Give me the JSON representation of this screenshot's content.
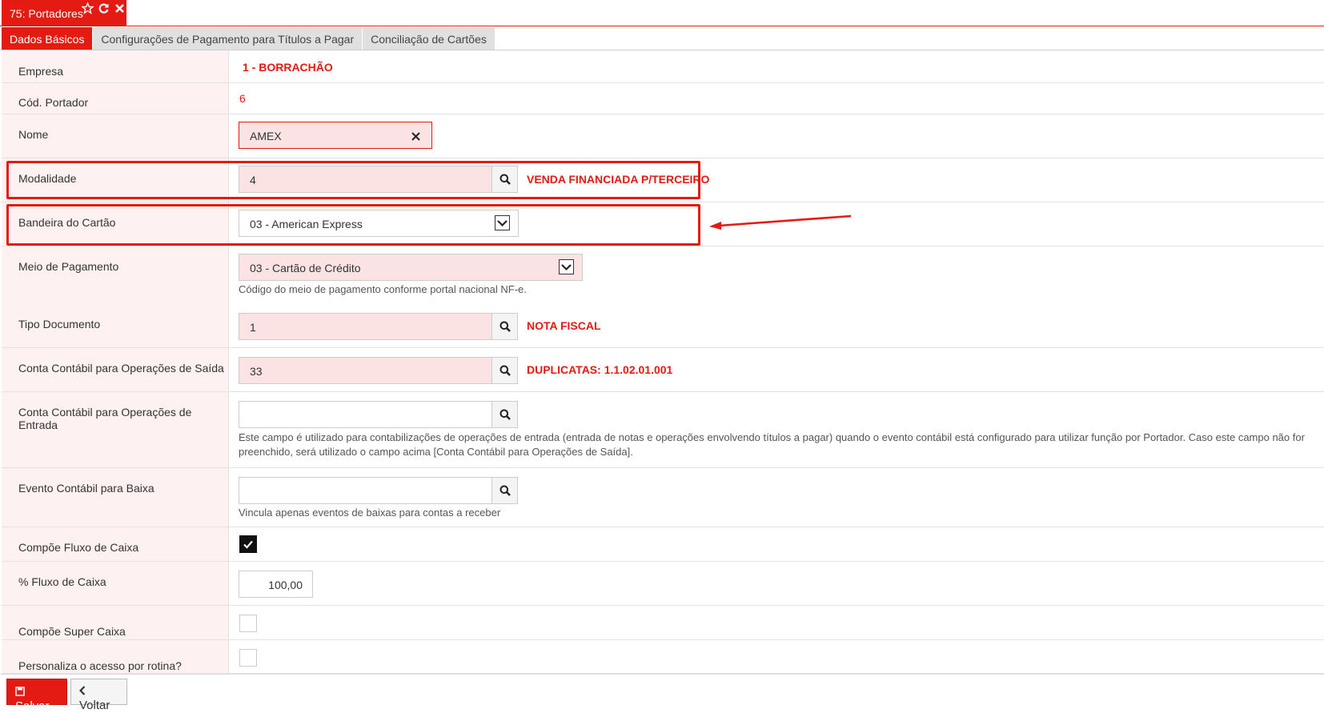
{
  "window": {
    "title": "75: Portadores"
  },
  "tabs": [
    {
      "label": "Dados Básicos"
    },
    {
      "label": "Configurações de Pagamento para Títulos a Pagar"
    },
    {
      "label": "Conciliação de Cartões"
    }
  ],
  "form": {
    "empresa": {
      "label": "Empresa",
      "value": "1 - BORRACHÃO"
    },
    "cod_portador": {
      "label": "Cód. Portador",
      "value": "6"
    },
    "nome": {
      "label": "Nome",
      "value": "AMEX"
    },
    "modalidade": {
      "label": "Modalidade",
      "value": "4",
      "description": "VENDA FINANCIADA P/TERCEIRO"
    },
    "bandeira": {
      "label": "Bandeira do Cartão",
      "value": "03 - American Express"
    },
    "meio_pagamento": {
      "label": "Meio de Pagamento",
      "value": "03 - Cartão de Crédito",
      "help": "Código do meio de pagamento conforme portal nacional NF-e."
    },
    "tipo_documento": {
      "label": "Tipo Documento",
      "value": "1",
      "description": "NOTA FISCAL"
    },
    "conta_saida": {
      "label": "Conta Contábil para Operações de Saída",
      "value": "33",
      "description": "DUPLICATAS: 1.1.02.01.001"
    },
    "conta_entrada": {
      "label": "Conta Contábil para Operações de Entrada",
      "value": "",
      "help_line1": "Este campo é utilizado para contabilizações de operações de entrada (entrada de notas e operações envolvendo títulos a pagar) quando o evento contábil está configurado para utilizar função por Portador. Caso este campo não for",
      "help_line2": "preenchido, será utilizado o campo acima [Conta Contábil para Operações de Saída]."
    },
    "evento_baixa": {
      "label": "Evento Contábil para Baixa",
      "value": "",
      "help": "Vincula apenas eventos de baixas para contas a receber"
    },
    "compoe_fluxo": {
      "label": "Compõe Fluxo de Caixa",
      "checked": true
    },
    "perc_fluxo": {
      "label": "% Fluxo de Caixa",
      "value": "100,00"
    },
    "compoe_super": {
      "label": "Compõe Super Caixa",
      "checked": false
    },
    "personaliza": {
      "label": "Personaliza o acesso por rotina?",
      "checked": false
    }
  },
  "footer": {
    "save_label": "Salvar",
    "back_label": "Voltar"
  },
  "colors": {
    "accent": "#e41b13",
    "label_bg": "#fdf1f1",
    "input_required_bg": "#fbe3e3"
  }
}
